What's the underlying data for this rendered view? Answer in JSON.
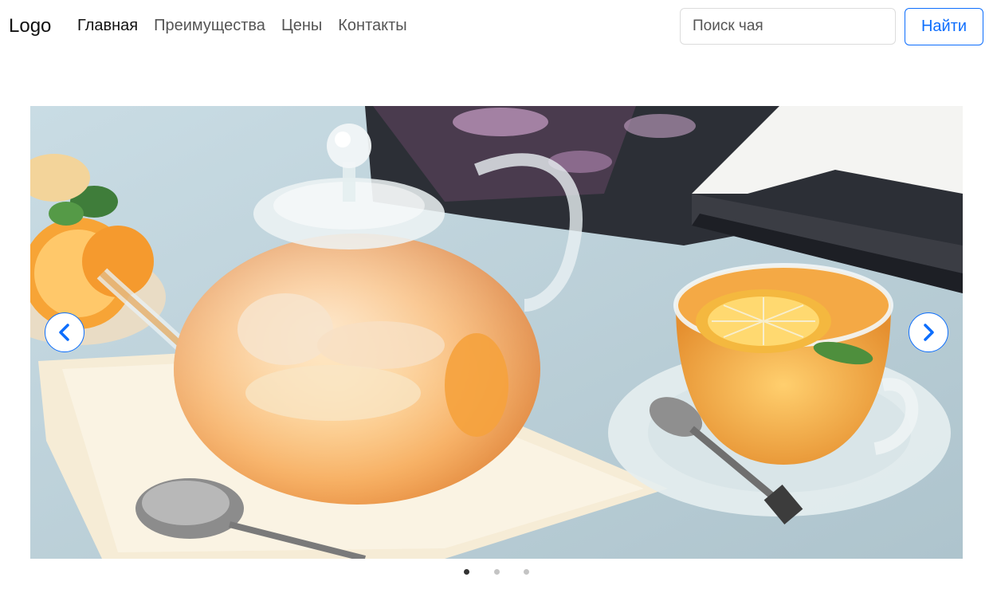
{
  "header": {
    "logo": "Logo",
    "nav": [
      {
        "label": "Главная",
        "active": true
      },
      {
        "label": "Преимущества",
        "active": false
      },
      {
        "label": "Цены",
        "active": false
      },
      {
        "label": "Контакты",
        "active": false
      }
    ],
    "search": {
      "placeholder": "Поиск чая",
      "value": "",
      "button_label": "Найти"
    }
  },
  "carousel": {
    "slide_count": 3,
    "active_slide": 1,
    "slide_image": "tea-glass-teapot-with-orange-and-cup-photo",
    "prev_icon": "chevron-left-icon",
    "next_icon": "chevron-right-icon"
  },
  "colors": {
    "accent": "#0d6efd",
    "active_dot": "#333333",
    "inactive_dot": "#c4c4c4"
  }
}
